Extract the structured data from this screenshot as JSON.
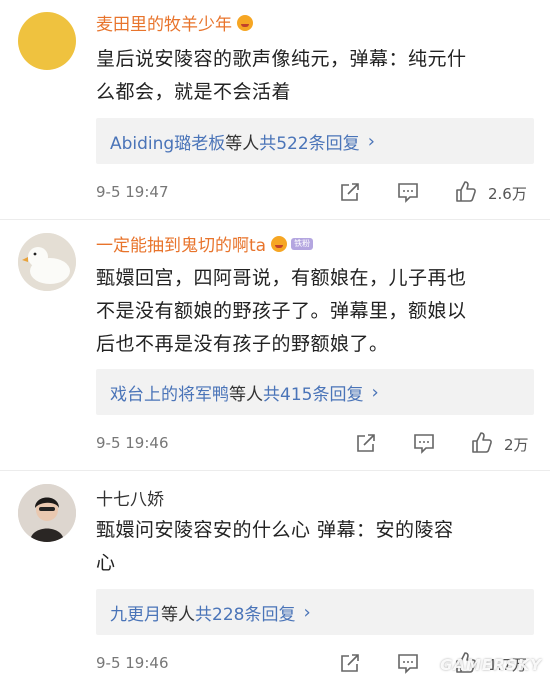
{
  "comments": [
    {
      "username": "麦田里的牧羊少年",
      "line1": "皇后说安陵容的歌声像纯元，弹幕：纯元什",
      "line2": "么都会，就是不会活着",
      "line3": "",
      "reply_who": "Abiding璐老板",
      "reply_mid": "等人",
      "reply_count": "共522条回复",
      "time": "9-5 19:47",
      "likes": "2.6万"
    },
    {
      "username": "一定能抽到鬼切的啊ta",
      "badge": "铁粉",
      "line1": "甄嬛回宫，四阿哥说，有额娘在，儿子再也",
      "line2": "不是没有额娘的野孩子了。弹幕里，额娘以",
      "line3": "后也不再是没有孩子的野额娘了。",
      "reply_who": "戏台上的将军鸭",
      "reply_mid": "等人",
      "reply_count": "共415条回复",
      "time": "9-5 19:46",
      "likes": "2万"
    },
    {
      "username": "十七八娇",
      "line1": "甄嬛问安陵容安的什么心 弹幕：安的陵容",
      "line2": "心",
      "line3": "",
      "reply_who": "九更月",
      "reply_mid": "等人",
      "reply_count": "共228条回复",
      "time": "9-5 19:46",
      "likes": "1.7万"
    }
  ],
  "icons": {
    "share": "share-icon",
    "comment": "comment-icon",
    "like": "thumbs-up-icon"
  },
  "colors": {
    "username": "#e8742c",
    "link": "#4a74b8",
    "reply_bg": "#f2f2f2"
  },
  "watermark": "GAMERSKY"
}
